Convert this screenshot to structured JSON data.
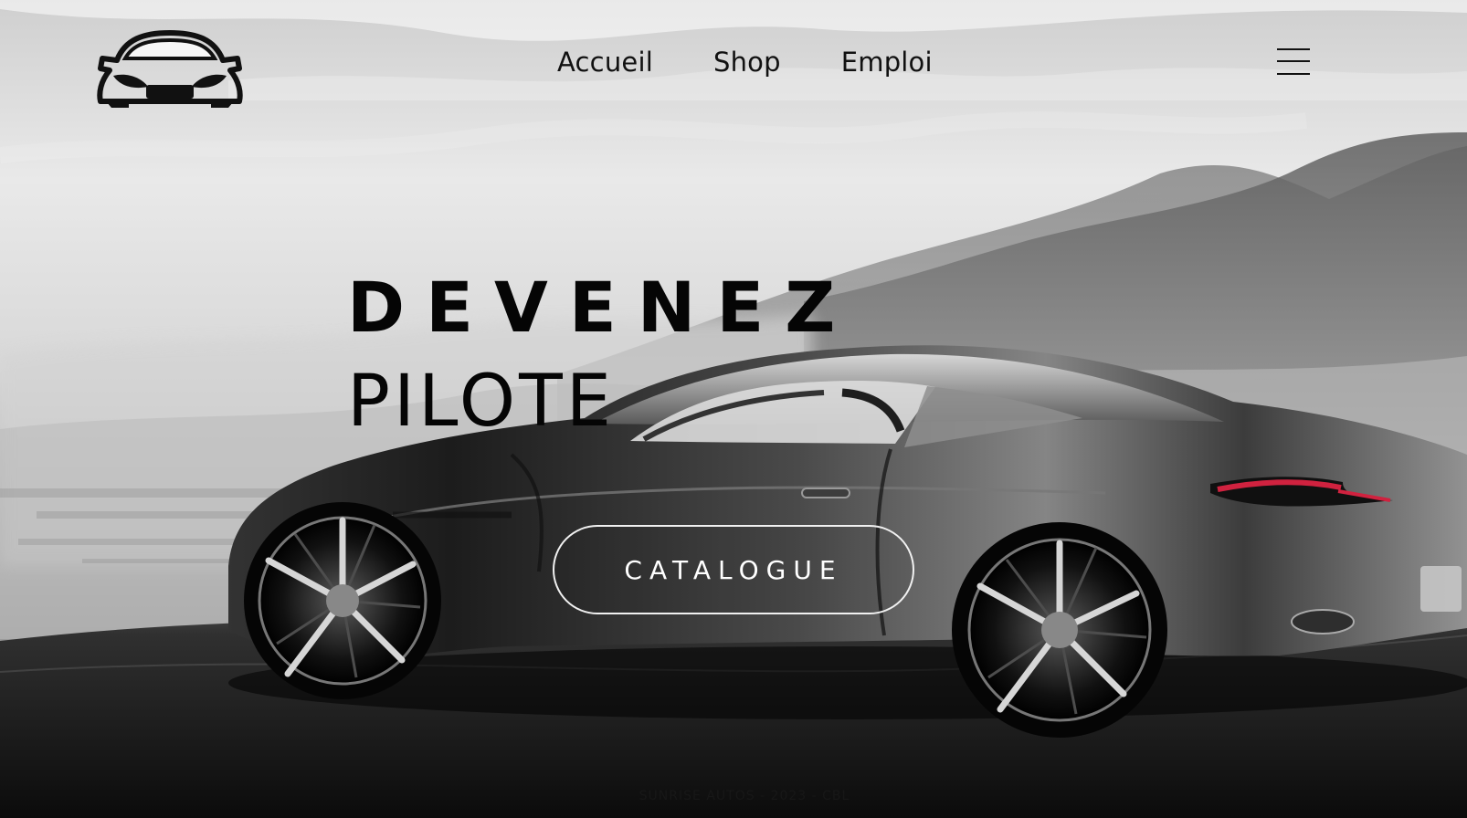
{
  "navigation": {
    "links": [
      {
        "label": "Accueil"
      },
      {
        "label": "Shop"
      },
      {
        "label": "Emploi"
      }
    ],
    "menu_icon": "hamburger-menu-icon",
    "logo_icon": "car-front-logo-icon"
  },
  "hero": {
    "headline_line1": "DEVENEZ",
    "headline_line2": "PILOTE",
    "button_label": "CATALOGUE",
    "background_image": "sports-car-on-mountain-road"
  },
  "footer": {
    "text": "SUNRISE AUTOS - 2023 - CBL"
  },
  "colors": {
    "text_dark": "#111111",
    "button_border": "#f1f1f1",
    "button_text": "#ffffff",
    "tail_light": "#c91d3a"
  }
}
